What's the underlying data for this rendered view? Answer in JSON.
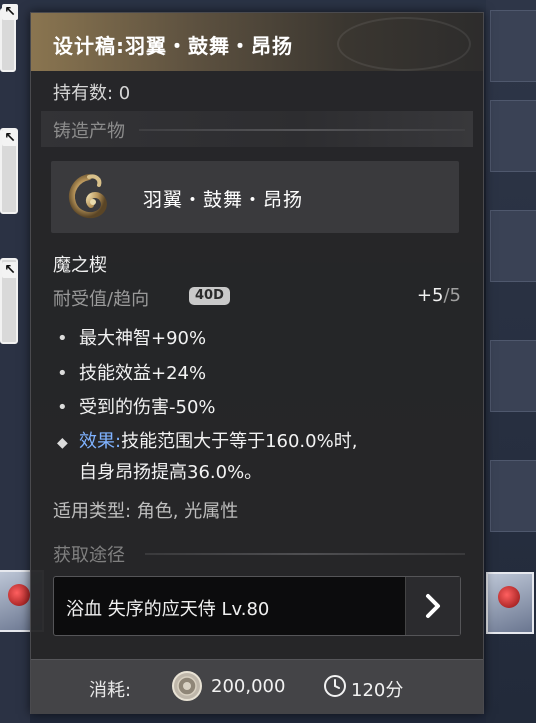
{
  "panel": {
    "title": "设计稿:羽翼・鼓舞・昂扬",
    "owned": "持有数: 0",
    "forge_section": "铸造产物",
    "forge_tail": "铸造产物",
    "product_name": "羽翼・鼓舞・昂扬",
    "item_name": "魔之楔",
    "durability_label": "耐受值/趋向",
    "durability_badge": "40D",
    "durability_current": "+5",
    "durability_max": "/5",
    "stats": [
      "最大神智+90%",
      "技能效益+24%",
      "受到的伤害-50%"
    ],
    "effect_label": "效果:",
    "effect_line1": "技能范围大于等于160.0%时,",
    "effect_line2": "自身昂扬提高36.0%。",
    "types": "适用类型: 角色, 光属性",
    "acquire_section": "获取途径",
    "acquire_tail": "获取途径",
    "source": "浴血 失序的应天侍 Lv.80",
    "cost_label": "消耗:",
    "cost_value": "200,000",
    "time_value": "120分"
  },
  "icons": {
    "product": "wing-curl-icon",
    "coin": "coin-icon",
    "clock": "clock-icon",
    "arrow": "chevron-right-icon"
  },
  "colors": {
    "effect_label": "#7fb2ff",
    "title_gold": "#8a7550"
  }
}
